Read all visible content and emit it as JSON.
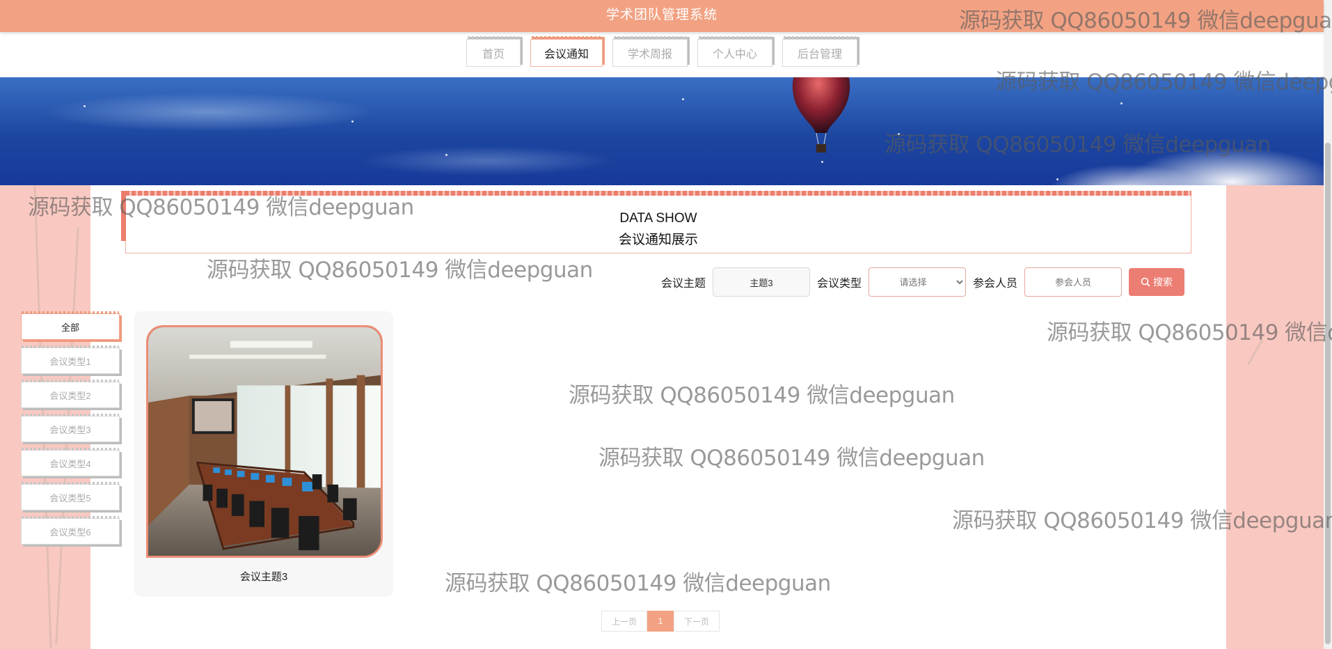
{
  "header": {
    "title": "学术团队管理系统"
  },
  "nav": {
    "items": [
      "首页",
      "会议通知",
      "学术周报",
      "个人中心",
      "后台管理"
    ],
    "active_index": 1
  },
  "section": {
    "en_title": "DATA SHOW",
    "cn_title": "会议通知展示"
  },
  "search": {
    "subject_label": "会议主题",
    "subject_value": "主题3",
    "type_label": "会议类型",
    "type_selected": "请选择",
    "people_label": "参会人员",
    "people_placeholder": "参会人员",
    "button_label": "搜索",
    "button_icon": "search-icon"
  },
  "categories": {
    "items": [
      "全部",
      "会议类型1",
      "会议类型2",
      "会议类型3",
      "会议类型4",
      "会议类型5",
      "会议类型6"
    ],
    "active_index": 0
  },
  "cards": [
    {
      "title": "会议主题3"
    }
  ],
  "pagination": {
    "prev": "上一页",
    "current": "1",
    "next": "下一页"
  },
  "watermark": "源码获取 QQ86050149 微信deepguan",
  "colors": {
    "accent": "#f2a283",
    "search_button": "#ec7d72",
    "banner": "#1c46a0"
  }
}
